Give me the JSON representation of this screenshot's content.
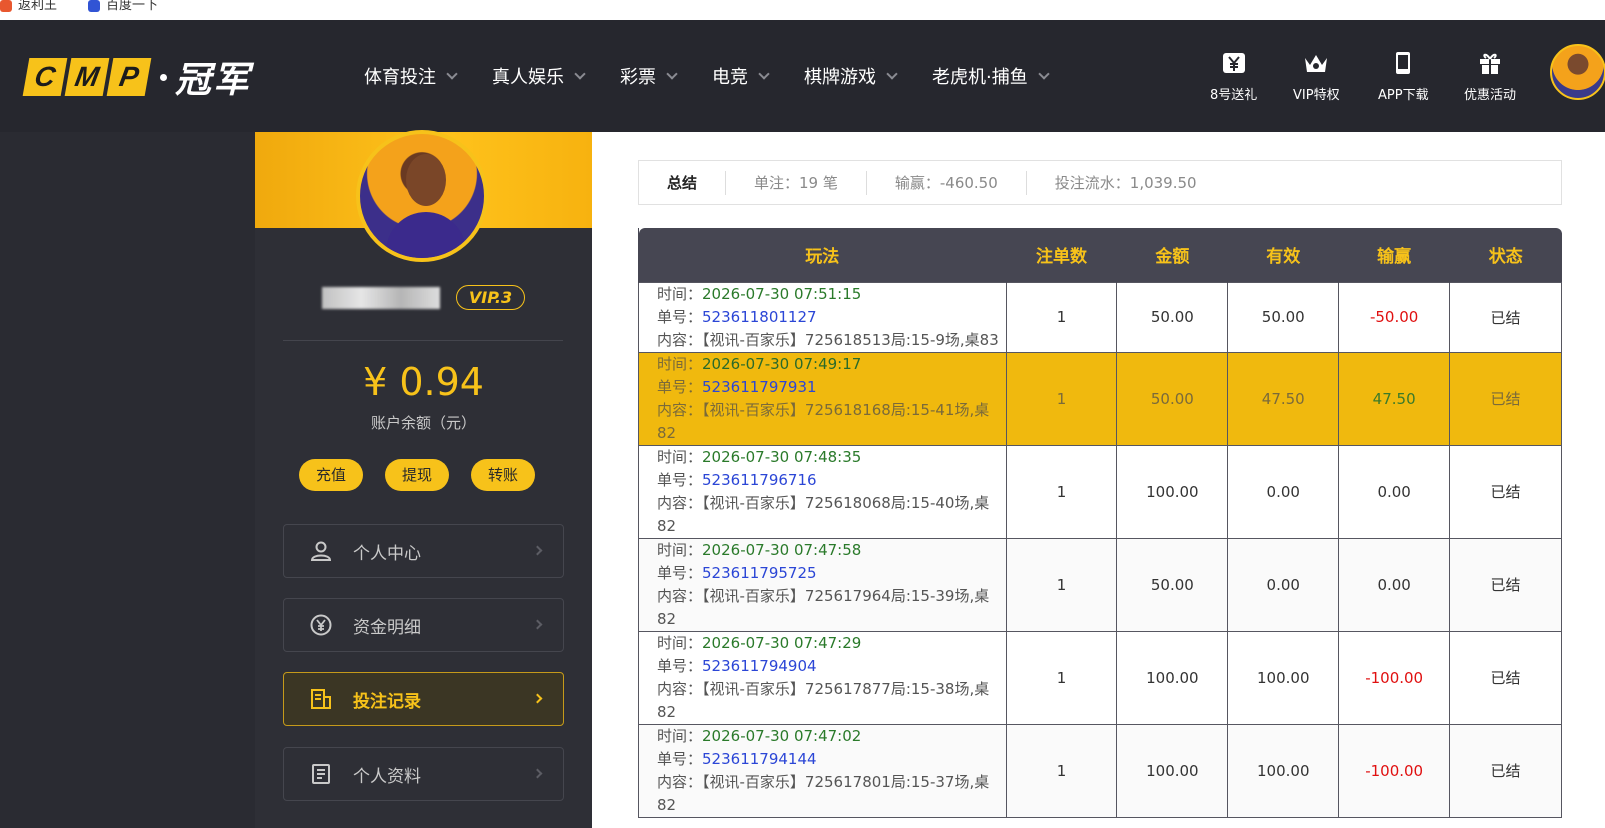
{
  "bookmarks": [
    {
      "label": "返利王"
    },
    {
      "label": "百度一下"
    }
  ],
  "header": {
    "logo_text": "CMP",
    "logo_cn": "冠军",
    "nav": [
      {
        "label": "体育投注"
      },
      {
        "label": "真人娱乐"
      },
      {
        "label": "彩票"
      },
      {
        "label": "电竞"
      },
      {
        "label": "棋牌游戏"
      },
      {
        "label": "老虎机·捕鱼"
      }
    ],
    "quick_links": [
      {
        "label": "8号送礼",
        "icon": "yen-gift-icon"
      },
      {
        "label": "VIP特权",
        "icon": "crown-icon"
      },
      {
        "label": "APP下载",
        "icon": "phone-icon"
      },
      {
        "label": "优惠活动",
        "icon": "gift-icon"
      }
    ]
  },
  "profile": {
    "vip": "VIP.3",
    "balance": "¥ 0.94",
    "balance_label": "账户余额（元）",
    "actions": [
      "充值",
      "提现",
      "转账"
    ],
    "menu": [
      {
        "label": "个人中心",
        "icon": "user-icon"
      },
      {
        "label": "资金明细",
        "icon": "money-cycle-icon"
      },
      {
        "label": "投注记录",
        "icon": "record-icon",
        "active": true
      },
      {
        "label": "个人资料",
        "icon": "document-icon"
      }
    ]
  },
  "summary": {
    "title": "总结",
    "bets": "单注：19 笔",
    "winloss": "输赢：-460.50",
    "turnover": "投注流水：1,039.50"
  },
  "table": {
    "headers": [
      "玩法",
      "注单数",
      "金额",
      "有效",
      "输赢",
      "状态"
    ],
    "labels": {
      "time": "时间：",
      "order": "单号：",
      "content": "内容："
    },
    "rows": [
      {
        "time": "2026-07-30 07:51:15",
        "order": "523611801127",
        "content": "【视讯-百家乐】725618513局:15-9场,桌83",
        "count": "1",
        "amount": "50.00",
        "valid": "50.00",
        "winloss": "-50.00",
        "status": "已结"
      },
      {
        "time": "2026-07-30 07:49:17",
        "order": "523611797931",
        "content": "【视讯-百家乐】725618168局:15-41场,桌82",
        "count": "1",
        "amount": "50.00",
        "valid": "47.50",
        "winloss": "47.50",
        "status": "已结"
      },
      {
        "time": "2026-07-30 07:48:35",
        "order": "523611796716",
        "content": "【视讯-百家乐】725618068局:15-40场,桌82",
        "count": "1",
        "amount": "100.00",
        "valid": "0.00",
        "winloss": "0.00",
        "status": "已结"
      },
      {
        "time": "2026-07-30 07:47:58",
        "order": "523611795725",
        "content": "【视讯-百家乐】725617964局:15-39场,桌82",
        "count": "1",
        "amount": "50.00",
        "valid": "0.00",
        "winloss": "0.00",
        "status": "已结"
      },
      {
        "time": "2026-07-30 07:47:29",
        "order": "523611794904",
        "content": "【视讯-百家乐】725617877局:15-38场,桌82",
        "count": "1",
        "amount": "100.00",
        "valid": "100.00",
        "winloss": "-100.00",
        "status": "已结"
      },
      {
        "time": "2026-07-30 07:47:02",
        "order": "523611794144",
        "content": "【视讯-百家乐】725617801局:15-37场,桌82",
        "count": "1",
        "amount": "100.00",
        "valid": "100.00",
        "winloss": "-100.00",
        "status": "已结"
      }
    ]
  },
  "colors": {
    "accent": "#f7c21a",
    "header_bg": "#26272e",
    "panel_bg": "#2e2f36",
    "table_header_bg": "#464652",
    "loss": "#e01010",
    "time_green": "#2a7a2a",
    "order_blue": "#2b46d6"
  }
}
